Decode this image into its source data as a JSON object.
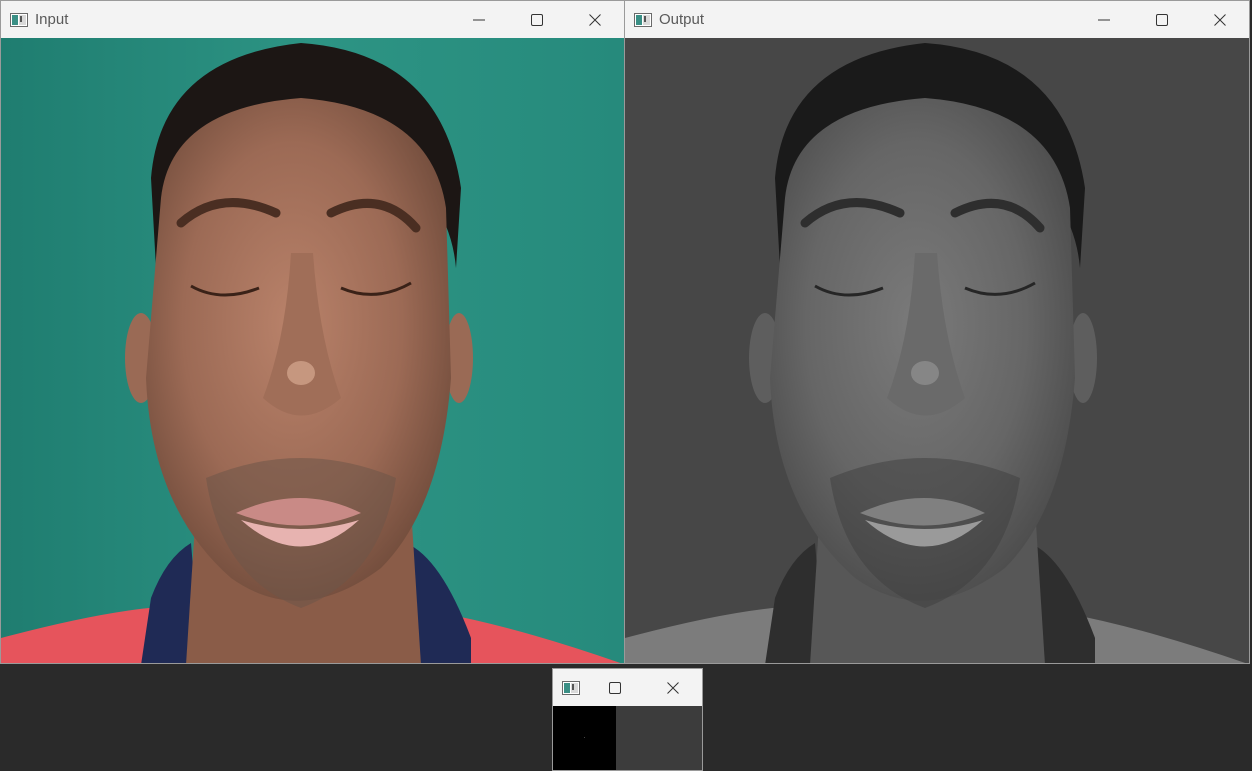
{
  "windows": {
    "input": {
      "title": "Input",
      "icon": "window-app-icon",
      "controls": [
        "minimize-icon",
        "maximize-icon",
        "close-icon"
      ]
    },
    "output": {
      "title": "Output",
      "icon": "window-app-icon",
      "controls": [
        "minimize-icon",
        "maximize-icon",
        "close-icon"
      ]
    },
    "small": {
      "title": "",
      "icon": "window-app-icon",
      "controls": [
        "maximize-icon",
        "close-icon"
      ]
    }
  },
  "colors": {
    "desktop": "#2a2a2a",
    "titlebar": "#f3f3f3",
    "input_background": "#2f8f7f",
    "output_background": "#4a4a4a"
  }
}
